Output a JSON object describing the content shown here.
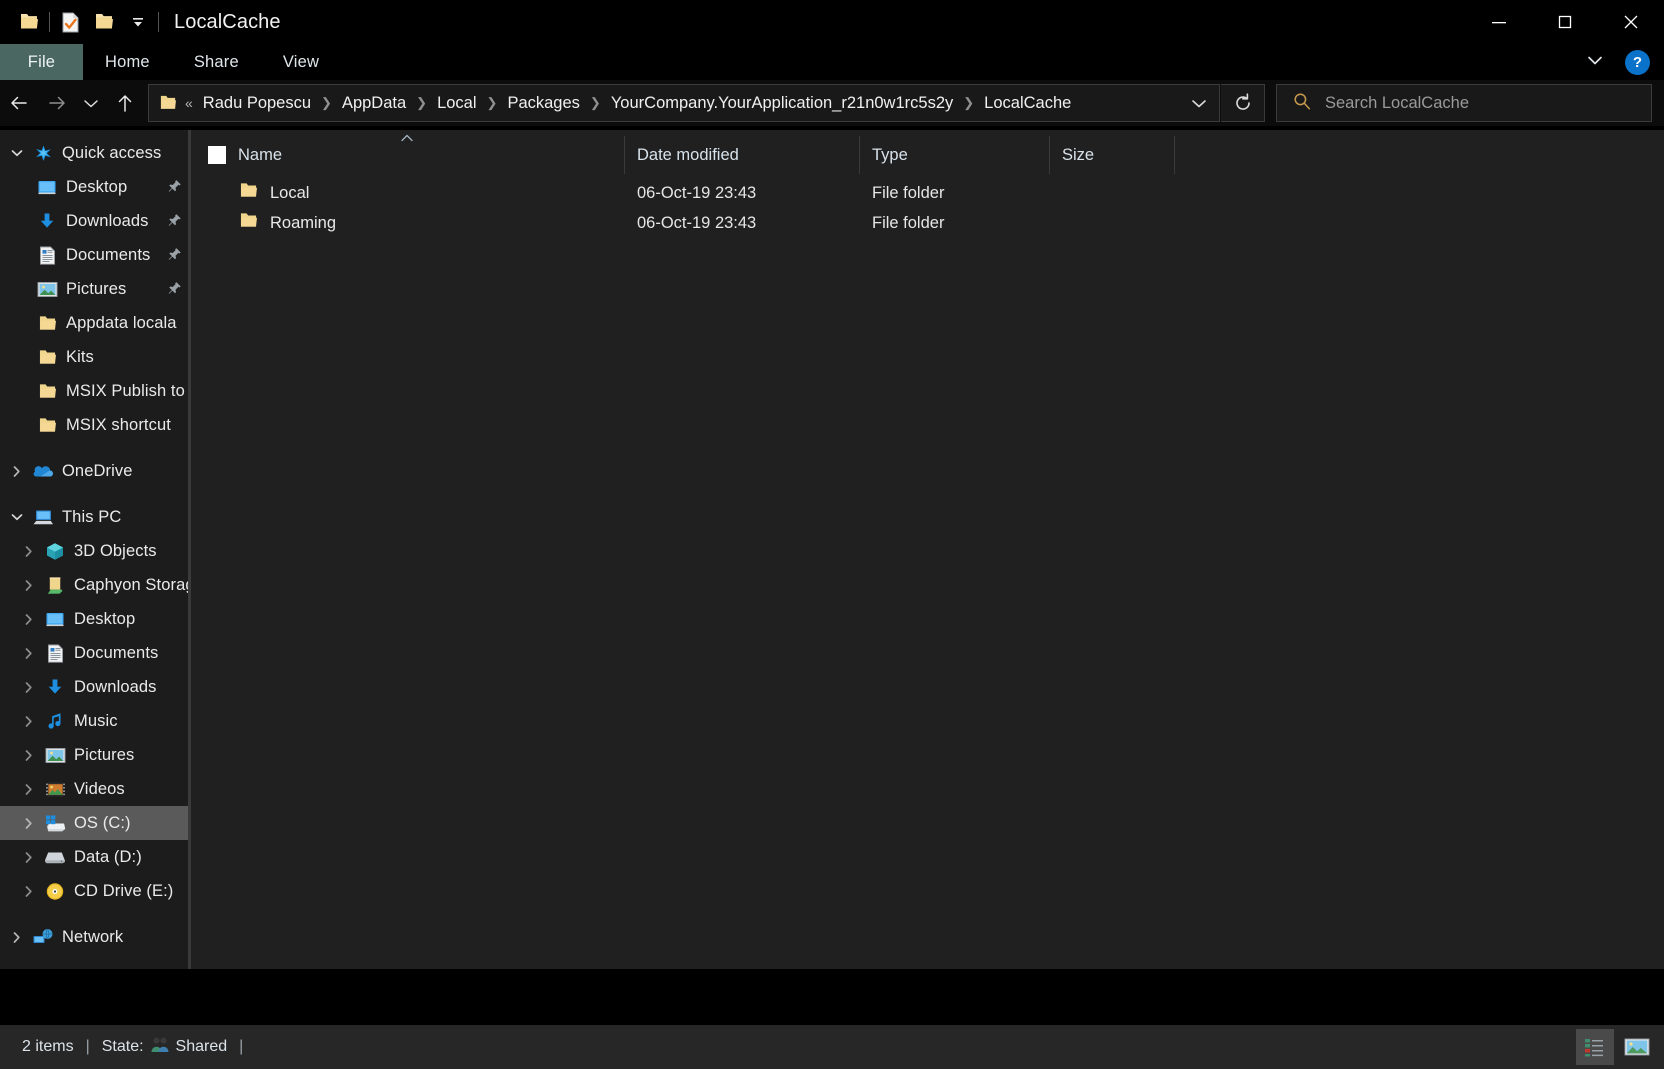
{
  "window": {
    "title": "LocalCache",
    "quick_access_toolbar": [
      {
        "name": "folder-icon",
        "label": "Folder"
      },
      {
        "name": "properties-icon",
        "label": "Properties"
      },
      {
        "name": "new-folder-icon",
        "label": "New folder"
      },
      {
        "name": "customize-qat-icon",
        "label": "Customize Quick Access Toolbar"
      }
    ],
    "controls": {
      "minimize": "Minimize",
      "maximize": "Maximize",
      "close": "Close"
    }
  },
  "ribbon": {
    "tabs": [
      {
        "label": "File",
        "active": true
      },
      {
        "label": "Home",
        "active": false
      },
      {
        "label": "Share",
        "active": false
      },
      {
        "label": "View",
        "active": false
      }
    ],
    "expand_label": "Expand the Ribbon",
    "help_label": "?"
  },
  "navigation": {
    "back": "Back",
    "forward": "Forward",
    "recent": "Recent locations",
    "up": "Up",
    "overflow": "«",
    "breadcrumbs": [
      "Radu Popescu",
      "AppData",
      "Local",
      "Packages",
      "YourCompany.YourApplication_r21n0w1rc5s2y",
      "LocalCache"
    ],
    "dropdown": "Previous locations",
    "refresh": "Refresh"
  },
  "search": {
    "placeholder": "Search LocalCache",
    "icon": "search-icon"
  },
  "sidebar": {
    "groups": [
      {
        "name": "Quick access",
        "icon": "star-icon",
        "expanded": true,
        "items": [
          {
            "label": "Desktop",
            "icon": "desktop-icon",
            "pinned": true
          },
          {
            "label": "Downloads",
            "icon": "download-icon",
            "pinned": true
          },
          {
            "label": "Documents",
            "icon": "document-icon",
            "pinned": true
          },
          {
            "label": "Pictures",
            "icon": "pictures-icon",
            "pinned": true
          },
          {
            "label": "Appdata locala",
            "icon": "folder-icon",
            "pinned": false
          },
          {
            "label": "Kits",
            "icon": "folder-icon",
            "pinned": false
          },
          {
            "label": "MSIX Publish to",
            "icon": "folder-icon",
            "pinned": false
          },
          {
            "label": "MSIX shortcut",
            "icon": "folder-icon",
            "pinned": false
          }
        ]
      },
      {
        "name": "OneDrive",
        "icon": "onedrive-icon",
        "expanded": false,
        "items": []
      },
      {
        "name": "This PC",
        "icon": "thispc-icon",
        "expanded": true,
        "items": [
          {
            "label": "3D Objects",
            "icon": "3dobjects-icon",
            "expandable": true
          },
          {
            "label": "Caphyon Storag",
            "icon": "folder-green-icon",
            "expandable": true
          },
          {
            "label": "Desktop",
            "icon": "desktop-icon",
            "expandable": true
          },
          {
            "label": "Documents",
            "icon": "document-icon",
            "expandable": true
          },
          {
            "label": "Downloads",
            "icon": "download-icon",
            "expandable": true
          },
          {
            "label": "Music",
            "icon": "music-icon",
            "expandable": true
          },
          {
            "label": "Pictures",
            "icon": "pictures-icon",
            "expandable": true
          },
          {
            "label": "Videos",
            "icon": "videos-icon",
            "expandable": true
          },
          {
            "label": "OS (C:)",
            "icon": "windows-drive-icon",
            "expandable": true,
            "selected": true
          },
          {
            "label": "Data (D:)",
            "icon": "drive-icon",
            "expandable": true
          },
          {
            "label": "CD Drive (E:)",
            "icon": "cd-drive-icon",
            "expandable": true
          }
        ]
      },
      {
        "name": "Network",
        "icon": "network-icon",
        "expanded": false,
        "items": []
      }
    ]
  },
  "file_list": {
    "columns": [
      {
        "label": "Name",
        "sorted": "asc"
      },
      {
        "label": "Date modified",
        "sorted": null
      },
      {
        "label": "Type",
        "sorted": null
      },
      {
        "label": "Size",
        "sorted": null
      }
    ],
    "rows": [
      {
        "name": "Local",
        "icon": "folder-icon",
        "date_modified": "06-Oct-19 23:43",
        "type": "File folder",
        "size": ""
      },
      {
        "name": "Roaming",
        "icon": "folder-icon",
        "date_modified": "06-Oct-19 23:43",
        "type": "File folder",
        "size": ""
      }
    ]
  },
  "status_bar": {
    "item_count": "2 items",
    "separator": "|",
    "state_label": "State:",
    "state_value": "Shared",
    "state_icon": "shared-people-icon",
    "view_buttons": [
      {
        "name": "details-view-button",
        "label": "Details view",
        "active": true
      },
      {
        "name": "large-icons-view-button",
        "label": "Large icons view",
        "active": false
      }
    ]
  },
  "colors": {
    "titlebar_bg": "#000000",
    "file_tab_bg": "#4a6861",
    "content_bg": "#202020",
    "sidebar_bg": "#1c1c1c",
    "status_bg": "#272727",
    "selection_bg": "#5a5a5a",
    "accent_blue": "#0a72c8",
    "folder_yellow": "#f5d68a"
  }
}
